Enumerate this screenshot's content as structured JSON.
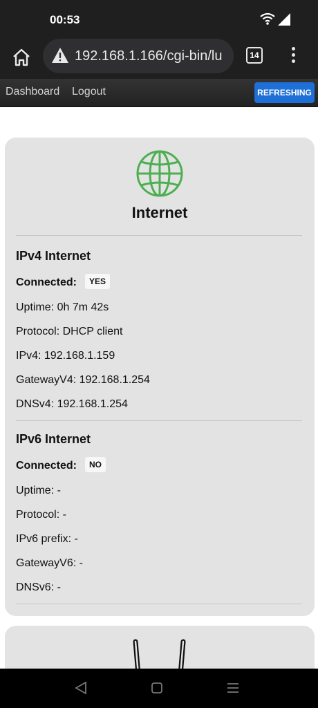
{
  "status_bar": {
    "time": "00:53",
    "wifi_icon": "wifi-icon",
    "signal_icon": "signal-icon"
  },
  "browser": {
    "home_icon": "home-icon",
    "warning_icon": "warning-icon",
    "url": "192.168.1.166/cgi-bin/lu",
    "tab_count": "14",
    "menu_icon": "more-vert-icon"
  },
  "navbar": {
    "dashboard_label": "Dashboard",
    "logout_label": "Logout",
    "refresh_label": "REFRESHING",
    "refresh_color": "#1e6fd6"
  },
  "internet_card": {
    "icon": "globe-icon",
    "icon_color": "#4caf50",
    "title": "Internet",
    "ipv4": {
      "heading": "IPv4 Internet",
      "connected_label": "Connected:",
      "connected_value": "YES",
      "uptime": "Uptime:  0h 7m 42s",
      "protocol": "Protocol:  DHCP client",
      "address": "IPv4:  192.168.1.159",
      "gateway": "GatewayV4:  192.168.1.254",
      "dns": "DNSv4:  192.168.1.254"
    },
    "ipv6": {
      "heading": "IPv6 Internet",
      "connected_label": "Connected:",
      "connected_value": "NO",
      "uptime": "Uptime:  -",
      "protocol": "Protocol:  -",
      "prefix": "IPv6 prefix:  -",
      "gateway": "GatewayV6:  -",
      "dns": "DNSv6:  -"
    }
  },
  "next_card": {
    "icon": "router-antenna-icon"
  },
  "system_nav": {
    "back_icon": "back-icon",
    "home_icon": "home-square-icon",
    "recents_icon": "recents-icon"
  }
}
